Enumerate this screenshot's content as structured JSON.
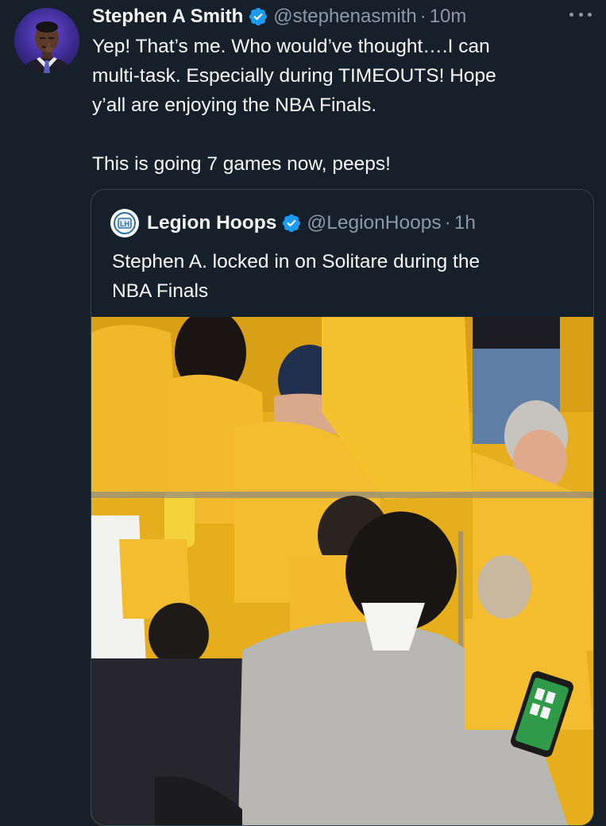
{
  "tweet": {
    "author_name": "Stephen A Smith",
    "handle": "@stephenasmith",
    "separator": "·",
    "time": "10m",
    "text_line_1": "Yep! That’s me. Who would’ve thought….I can",
    "text_line_2": "multi-task. Especially during TIMEOUTS! Hope",
    "text_line_3": "y’all are enjoying the NBA Finals.",
    "text_line_4": "This is going 7 games now, peeps!",
    "avatar_icon": "user-avatar",
    "verified_icon": "verified-badge-icon",
    "more_icon": "more-options-icon"
  },
  "quoted_tweet": {
    "author_name": "Legion Hoops",
    "handle": "@LegionHoops",
    "separator": "·",
    "time": "1h",
    "text_line_1": "Stephen A. locked in on Solitare during the",
    "text_line_2": "NBA Finals",
    "avatar_icon": "legion-hoops-logo",
    "media_icon": "photo-crowd-at-nba-finals"
  },
  "colors": {
    "background": "#15202b",
    "text_primary": "#f7f9f9",
    "text_secondary": "#8b98a5",
    "verified_blue": "#1d9bf0",
    "border": "#38444d",
    "photo_yellow": "#e9b420"
  }
}
